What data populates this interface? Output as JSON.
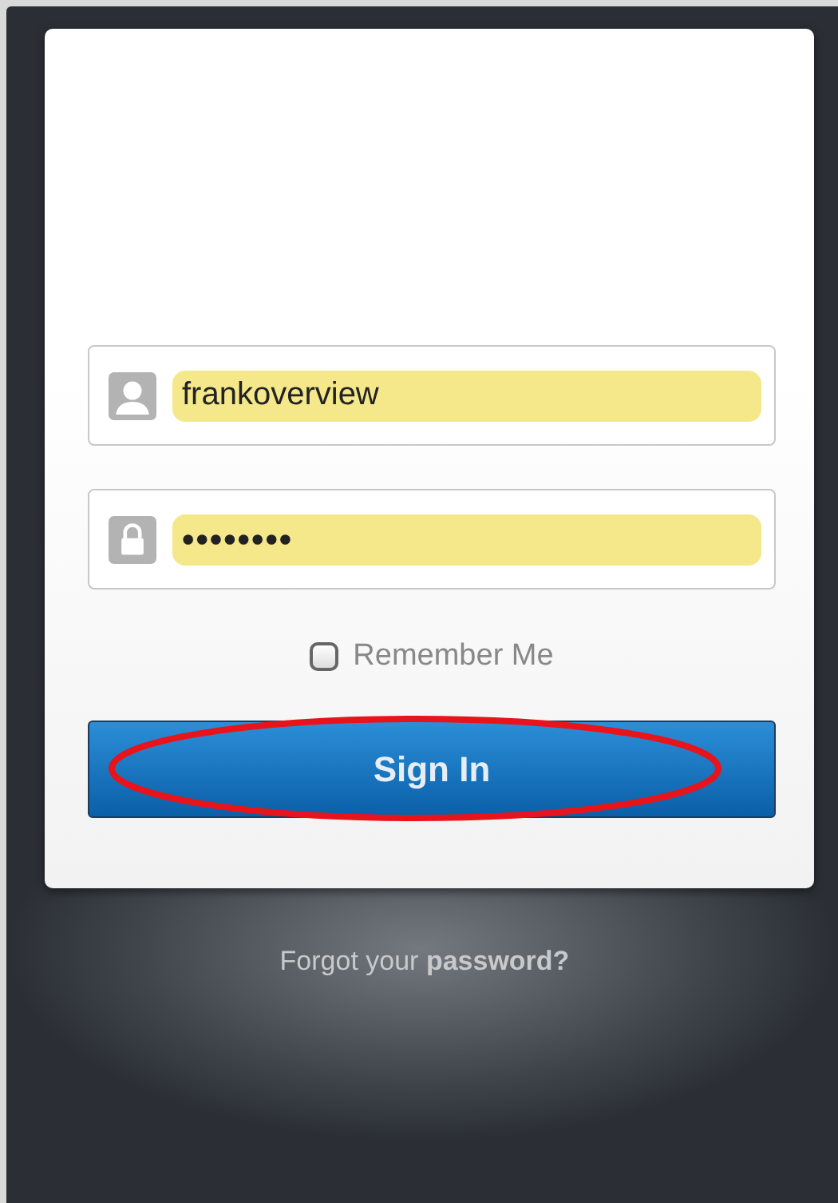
{
  "login_form": {
    "username": {
      "value": "frankoverview",
      "autofilled": true
    },
    "password": {
      "value": "••••••••",
      "autofilled": true
    },
    "remember_me": {
      "label": "Remember Me",
      "checked": false
    },
    "sign_in_button": {
      "label": "Sign In",
      "annotated": true
    }
  },
  "forgot_link": "Forgot your **password?**"
}
